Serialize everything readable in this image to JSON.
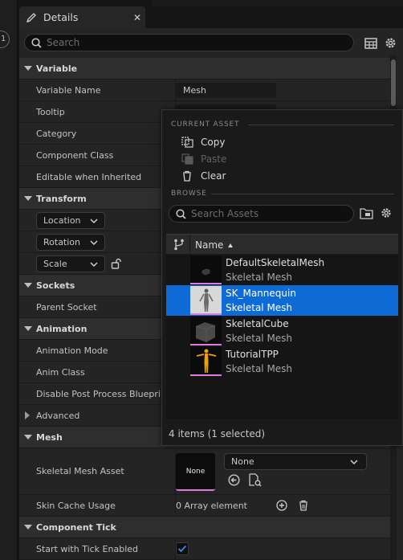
{
  "left_tab": {
    "label": "1"
  },
  "tab": {
    "title": "Details",
    "close": "✕"
  },
  "search": {
    "placeholder": "Search"
  },
  "categories": {
    "variable": "Variable",
    "transform": "Transform",
    "sockets": "Sockets",
    "animation": "Animation",
    "advanced": "Advanced",
    "mesh": "Mesh",
    "component_tick": "Component Tick"
  },
  "props": {
    "variable_name": "Variable Name",
    "variable_name_value": "Mesh",
    "tooltip": "Tooltip",
    "category": "Category",
    "component_class": "Component Class",
    "editable_when_inherited": "Editable when Inherited",
    "location": "Location",
    "rotation": "Rotation",
    "scale": "Scale",
    "parent_socket": "Parent Socket",
    "animation_mode": "Animation Mode",
    "anim_class": "Anim Class",
    "disable_post_process": "Disable Post Process Blueprint",
    "skeletal_mesh_asset": "Skeletal Mesh Asset",
    "mesh_thumb_label": "None",
    "mesh_combo_value": "None",
    "skin_cache_usage": "Skin Cache Usage",
    "skin_cache_value": "0 Array element",
    "start_with_tick_enabled": "Start with Tick Enabled",
    "start_with_tick_checked": true
  },
  "popup": {
    "current_asset_header": "CURRENT ASSET",
    "copy": "Copy",
    "paste": "Paste",
    "clear": "Clear",
    "browse_header": "BROWSE",
    "search_placeholder": "Search Assets",
    "column_name": "Name",
    "assets": [
      {
        "name": "DefaultSkeletalMesh",
        "type": "Skeletal Mesh",
        "selected": false
      },
      {
        "name": "SK_Mannequin",
        "type": "Skeletal Mesh",
        "selected": true
      },
      {
        "name": "SkeletalCube",
        "type": "Skeletal Mesh",
        "selected": false
      },
      {
        "name": "TutorialTPP",
        "type": "Skeletal Mesh",
        "selected": false
      }
    ],
    "item_count": "4 items (1 selected)"
  },
  "colors": {
    "selection": "#0e6bd6",
    "asset_accent": "#e07ae0",
    "checkbox": "#3d8bf2"
  }
}
